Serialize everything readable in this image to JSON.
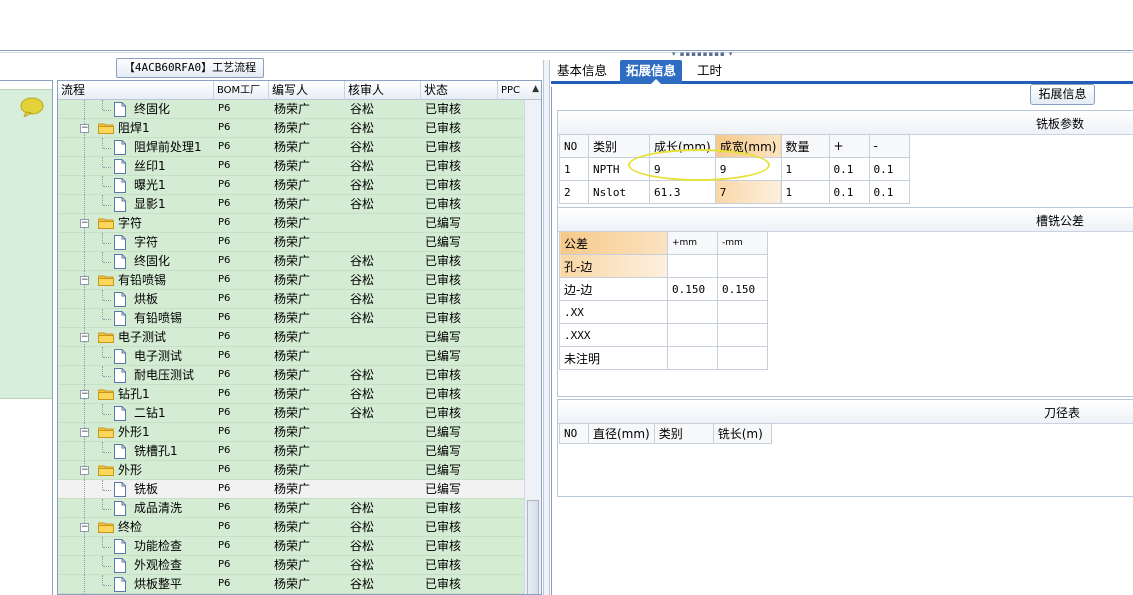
{
  "process_panel": {
    "title": "【4ACB60RFA0】工艺流程",
    "headers": [
      "流程",
      "BOM工厂",
      "编写人",
      "核审人",
      "状态",
      "PPC"
    ],
    "rows": [
      {
        "level": 2,
        "type": "doc",
        "name": "终固化",
        "bom": "P6",
        "writer": "杨荣广",
        "reviewer": "谷松",
        "status": "已审核"
      },
      {
        "level": 1,
        "type": "folder",
        "name": "阻焊1",
        "bom": "P6",
        "writer": "杨荣广",
        "reviewer": "谷松",
        "status": "已审核"
      },
      {
        "level": 2,
        "type": "doc",
        "name": "阻焊前处理1",
        "bom": "P6",
        "writer": "杨荣广",
        "reviewer": "谷松",
        "status": "已审核"
      },
      {
        "level": 2,
        "type": "doc",
        "name": "丝印1",
        "bom": "P6",
        "writer": "杨荣广",
        "reviewer": "谷松",
        "status": "已审核"
      },
      {
        "level": 2,
        "type": "doc",
        "name": "曝光1",
        "bom": "P6",
        "writer": "杨荣广",
        "reviewer": "谷松",
        "status": "已审核"
      },
      {
        "level": 2,
        "type": "doc",
        "name": "显影1",
        "bom": "P6",
        "writer": "杨荣广",
        "reviewer": "谷松",
        "status": "已审核"
      },
      {
        "level": 1,
        "type": "folder",
        "name": "字符",
        "bom": "P6",
        "writer": "杨荣广",
        "reviewer": "",
        "status": "已编写"
      },
      {
        "level": 2,
        "type": "doc",
        "name": "字符",
        "bom": "P6",
        "writer": "杨荣广",
        "reviewer": "",
        "status": "已编写"
      },
      {
        "level": 2,
        "type": "doc",
        "name": "终固化",
        "bom": "P6",
        "writer": "杨荣广",
        "reviewer": "谷松",
        "status": "已审核"
      },
      {
        "level": 1,
        "type": "folder",
        "name": "有铅喷锡",
        "bom": "P6",
        "writer": "杨荣广",
        "reviewer": "谷松",
        "status": "已审核"
      },
      {
        "level": 2,
        "type": "doc",
        "name": "烘板",
        "bom": "P6",
        "writer": "杨荣广",
        "reviewer": "谷松",
        "status": "已审核"
      },
      {
        "level": 2,
        "type": "doc",
        "name": "有铅喷锡",
        "bom": "P6",
        "writer": "杨荣广",
        "reviewer": "谷松",
        "status": "已审核"
      },
      {
        "level": 1,
        "type": "folder",
        "name": "电子测试",
        "bom": "P6",
        "writer": "杨荣广",
        "reviewer": "",
        "status": "已编写"
      },
      {
        "level": 2,
        "type": "doc",
        "name": "电子测试",
        "bom": "P6",
        "writer": "杨荣广",
        "reviewer": "",
        "status": "已编写"
      },
      {
        "level": 2,
        "type": "doc",
        "name": "耐电压测试",
        "bom": "P6",
        "writer": "杨荣广",
        "reviewer": "谷松",
        "status": "已审核"
      },
      {
        "level": 1,
        "type": "folder",
        "name": "钻孔1",
        "bom": "P6",
        "writer": "杨荣广",
        "reviewer": "谷松",
        "status": "已审核"
      },
      {
        "level": 2,
        "type": "doc",
        "name": "二钻1",
        "bom": "P6",
        "writer": "杨荣广",
        "reviewer": "谷松",
        "status": "已审核"
      },
      {
        "level": 1,
        "type": "folder",
        "name": "外形1",
        "bom": "P6",
        "writer": "杨荣广",
        "reviewer": "",
        "status": "已编写"
      },
      {
        "level": 2,
        "type": "doc",
        "name": "铣槽孔1",
        "bom": "P6",
        "writer": "杨荣广",
        "reviewer": "",
        "status": "已编写"
      },
      {
        "level": 1,
        "type": "folder",
        "name": "外形",
        "bom": "P6",
        "writer": "杨荣广",
        "reviewer": "",
        "status": "已编写"
      },
      {
        "level": 2,
        "type": "doc",
        "name": "铣板",
        "bom": "P6",
        "writer": "杨荣广",
        "reviewer": "",
        "status": "已编写",
        "selected": true
      },
      {
        "level": 2,
        "type": "doc",
        "name": "成品清洗",
        "bom": "P6",
        "writer": "杨荣广",
        "reviewer": "谷松",
        "status": "已审核"
      },
      {
        "level": 1,
        "type": "folder",
        "name": "终检",
        "bom": "P6",
        "writer": "杨荣广",
        "reviewer": "谷松",
        "status": "已审核"
      },
      {
        "level": 2,
        "type": "doc",
        "name": "功能检查",
        "bom": "P6",
        "writer": "杨荣广",
        "reviewer": "谷松",
        "status": "已审核"
      },
      {
        "level": 2,
        "type": "doc",
        "name": "外观检查",
        "bom": "P6",
        "writer": "杨荣广",
        "reviewer": "谷松",
        "status": "已审核"
      },
      {
        "level": 2,
        "type": "doc",
        "name": "烘板整平",
        "bom": "P6",
        "writer": "杨荣广",
        "reviewer": "谷松",
        "status": "已审核"
      }
    ]
  },
  "tabs": [
    "基本信息",
    "拓展信息",
    "工时"
  ],
  "active_tab": "拓展信息",
  "ext_tag": "拓展信息",
  "milling_params": {
    "title": "铣板参数",
    "headers": [
      "NO",
      "类别",
      "成长(mm)",
      "成宽(mm)",
      "数量",
      "+",
      "-"
    ],
    "rows": [
      [
        "1",
        "NPTH",
        "9",
        "9",
        "1",
        "0.1",
        "0.1"
      ],
      [
        "2",
        "Nslot",
        "61.3",
        "7",
        "1",
        "0.1",
        "0.1"
      ]
    ]
  },
  "slot_tolerance": {
    "title": "槽铣公差",
    "headers": [
      "公差",
      "+mm",
      "-mm"
    ],
    "rows": [
      [
        "孔-边",
        "",
        ""
      ],
      [
        "边-边",
        "0.150",
        "0.150"
      ],
      [
        ".XX",
        "",
        ""
      ],
      [
        ".XXX",
        "",
        ""
      ],
      [
        "未注明",
        "",
        ""
      ]
    ]
  },
  "tool_table": {
    "title": "刀径表",
    "headers": [
      "NO",
      "直径(mm)",
      "类别",
      "铣长(m)"
    ]
  },
  "colors": {
    "tree_row_bg": "#d5ecd4",
    "tab_active": "#2f6dc2",
    "highlight_cell": "#f6c98a",
    "annotation_ellipse": "#e6e23a"
  }
}
